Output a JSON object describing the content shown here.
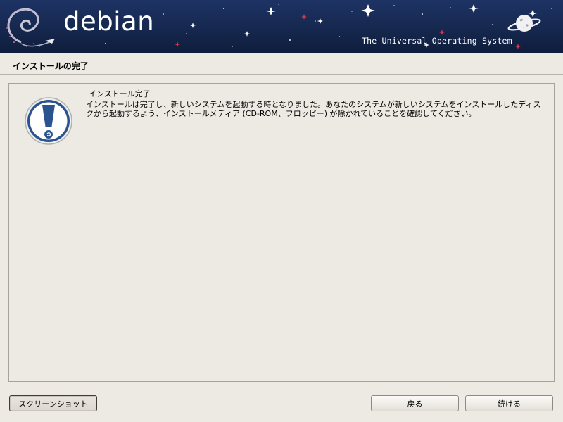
{
  "banner": {
    "logo_text": "debian",
    "tagline": "The Universal Operating System",
    "colors": {
      "background": "#1a2e5c",
      "swirl": "#d40a4a",
      "text": "#ffffff"
    },
    "icons": [
      "debian-swirl-icon",
      "planet-icon",
      "stars-decoration"
    ]
  },
  "page": {
    "title": "インストールの完了"
  },
  "message": {
    "icon": "info-exclamation-icon",
    "heading": "インストール完了",
    "body": "インストールは完了し、新しいシステムを起動する時となりました。あなたのシステムが新しいシステムをインストールしたディスクから起動するよう、インストールメディア (CD-ROM、フロッピー) が除かれていることを確認してください。"
  },
  "buttons": {
    "screenshot": "スクリーンショット",
    "back": "戻る",
    "continue": "続ける"
  }
}
